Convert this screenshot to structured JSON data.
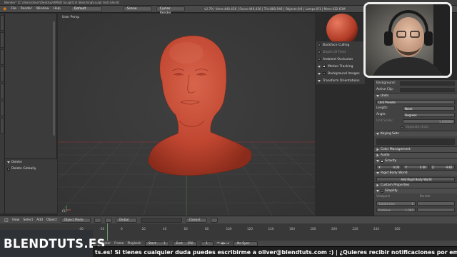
{
  "title_bar": "Blender* [C:\\Users\\oliver\\Desktop\\AMGD Sculpt\\1st Sketching\\sculpt test\\.blend]",
  "menu": {
    "items": [
      "File",
      "Render",
      "Window",
      "Help"
    ],
    "layout": "Default",
    "scene": "Scene",
    "engine": "Cycles Render",
    "stats": "v2.79 | Verts:440,436 | Faces:449,436 | Tris:880,946 | Objects:0/4 | Lamps:0/1 | Mem:432.63M"
  },
  "left_panel": {
    "lower_title": "Delete",
    "lower_item": "Delete Globally"
  },
  "viewport": {
    "label": "User Persp",
    "object_label": "(1)",
    "subject": "terracotta-bust-sculpt"
  },
  "shading_panel": {
    "items": [
      {
        "label": "Backface Culling",
        "checked": false
      },
      {
        "label": "Depth Of Field",
        "checked": false
      },
      {
        "label": "Ambient Occlusion",
        "checked": false
      },
      {
        "label": "Motion Tracking",
        "checked": true
      },
      {
        "label": "Background Images",
        "checked": false
      },
      {
        "label": "Transform Orientations",
        "checked": false
      }
    ]
  },
  "scene_panel": {
    "background_label": "Background:",
    "active_clip_label": "Active Clip:",
    "units_header": "Units",
    "unit_presets": "Unit Presets",
    "length_label": "Length:",
    "length_value": "None",
    "angle_label": "Angle:",
    "angle_value": "Degrees",
    "unit_scale_label": "Unit Scale:",
    "unit_scale_value": "1.000000",
    "separate_units": "Separate Units",
    "keying_sets_header": "Keying Sets",
    "color_mgmt_header": "Color Management",
    "audio_header": "Audio",
    "gravity_header": "Gravity",
    "gravity_x": "X:",
    "gravity_x_val": "0.00",
    "gravity_y": "Y:",
    "gravity_y_val": "0.00",
    "gravity_z": "Z:",
    "gravity_z_val": "-9.81",
    "rigid_body_header": "Rigid Body World",
    "rigid_body_btn": "Add Rigid Body World",
    "custom_props_header": "Custom Properties",
    "simplify_header": "Simplify",
    "viewport_label": "Viewport",
    "render_label": "Render",
    "subdivision_label": "Subdivision",
    "subdivision_val": "6",
    "particles_label": "Particles",
    "particles_val": "1.000"
  },
  "viewport_header": {
    "view": "View",
    "select": "Select",
    "add": "Add",
    "object": "Object",
    "mode": "Object Mode",
    "pivot": "Global",
    "snap": "Closest"
  },
  "timeline": {
    "ticks": [
      "-40",
      "-20",
      "0",
      "20",
      "40",
      "60",
      "80",
      "100",
      "120",
      "140",
      "160",
      "180",
      "200",
      "220",
      "240",
      "260"
    ],
    "view": "View",
    "marker": "Marker",
    "frame": "Frame",
    "playback": "Playback",
    "start_label": "Start:",
    "start_val": "1",
    "end_label": "End:",
    "end_val": "250",
    "current_val": "1",
    "sync": "No Sync"
  },
  "logo": "BLENDTUTS.ES",
  "ticker": "ts.es! Si tienes cualquier duda puedes escribirme a oliver@blendtuts.com :) | ¿Quieres recibir notificaciones por email cuando se",
  "colors": {
    "clay": "#c24a35",
    "clay_dark": "#7a2517",
    "grid_line": "#454545"
  }
}
